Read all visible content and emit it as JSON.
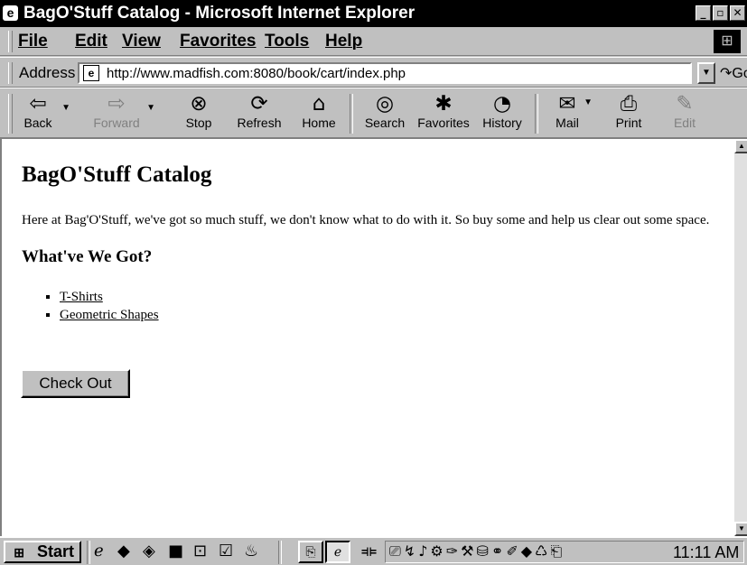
{
  "window": {
    "title": "BagO'Stuff Catalog - Microsoft Internet Explorer"
  },
  "menu": [
    "File",
    "Edit",
    "View",
    "Favorites",
    "Tools",
    "Help"
  ],
  "address": {
    "label": "Address",
    "url": "http://www.madfish.com:8080/book/cart/index.php",
    "go_label": "Go"
  },
  "toolbar": {
    "back": "Back",
    "forward": "Forward",
    "stop": "Stop",
    "refresh": "Refresh",
    "home": "Home",
    "search": "Search",
    "favorites": "Favorites",
    "history": "History",
    "mail": "Mail",
    "print": "Print",
    "edit": "Edit"
  },
  "page": {
    "heading": "BagO'Stuff Catalog",
    "intro": "Here at Bag'O'Stuff, we've got so much stuff, we don't know what to do with it. So buy some and help us clear out some space.",
    "subheading": "What've We Got?",
    "links": [
      "T-Shirts",
      "Geometric Shapes"
    ],
    "checkout_button": "Check Out"
  },
  "taskbar": {
    "start": "Start",
    "clock": "11:11 AM"
  },
  "icons": {
    "app": "ie-icon",
    "back": "back-arrow-icon",
    "forward": "forward-arrow-icon",
    "stop": "stop-icon",
    "refresh": "refresh-icon",
    "home": "home-icon",
    "search": "search-icon",
    "favorites": "favorites-icon",
    "history": "history-icon",
    "mail": "mail-icon",
    "print": "printer-icon",
    "edit": "edit-icon"
  }
}
